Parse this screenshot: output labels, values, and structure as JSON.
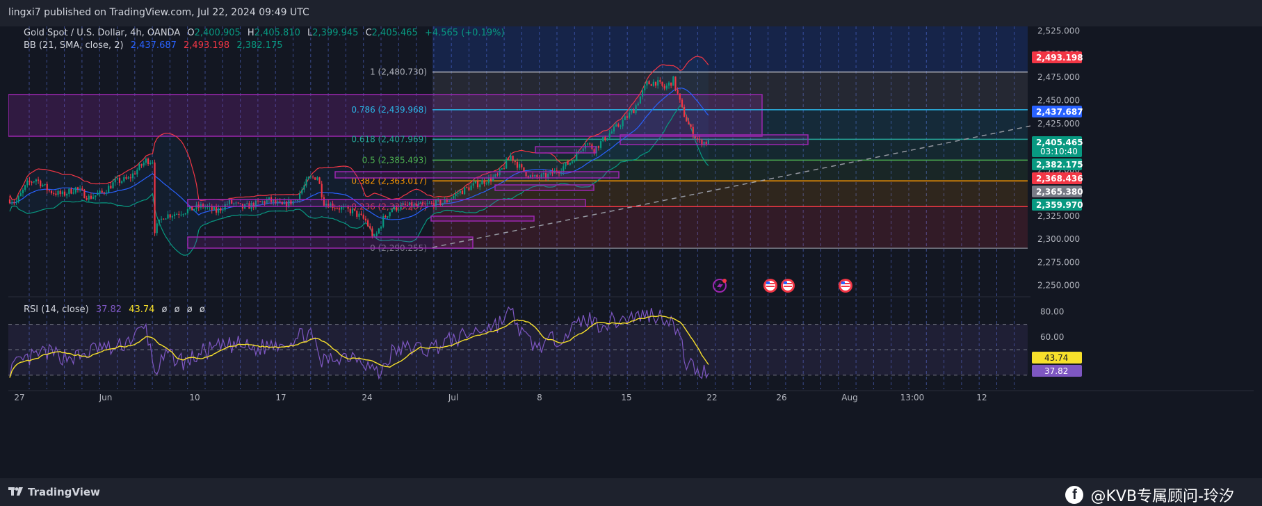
{
  "header": {
    "publish_text": "lingxi7 published on TradingView.com, Jul 22, 2024 09:49 UTC"
  },
  "legend": {
    "symbol": "Gold Spot / U.S. Dollar, 4h, OANDA",
    "open_label": "O",
    "open": "2,400.905",
    "high_label": "H",
    "high": "2,405.810",
    "low_label": "L",
    "low": "2,399.945",
    "close_label": "C",
    "close": "2,405.465",
    "change": "+4.565 (+0.19%)",
    "bb_label": "BB (21, SMA, close, 2)",
    "bb_basis": "2,437.687",
    "bb_upper": "2,493.198",
    "bb_lower": "2,382.175",
    "rsi_label": "RSI (14, close)",
    "rsi_value": "37.82",
    "rsi_ma": "43.74",
    "rsi_extra": [
      "ø",
      "ø",
      "ø",
      "ø"
    ]
  },
  "price_axis": {
    "ticks": [
      "2,525.000",
      "2,500.000",
      "2,475.000",
      "2,450.000",
      "2,425.000",
      "2,400.000",
      "2,375.000",
      "2,350.000",
      "2,325.000",
      "2,300.000",
      "2,275.000",
      "2,250.000"
    ],
    "badges": [
      {
        "value": "2,493.198",
        "color": "#f23645"
      },
      {
        "value": "2,437.687",
        "color": "#2962ff"
      },
      {
        "value": "2,405.465",
        "color": "#089981",
        "sub": "03:10:40"
      },
      {
        "value": "2,382.175",
        "color": "#089981"
      },
      {
        "value": "2,368.436",
        "color": "#f23645"
      },
      {
        "value": "2,365.380",
        "color": "#787b86"
      },
      {
        "value": "2,359.970",
        "color": "#089981"
      }
    ]
  },
  "rsi_axis": {
    "ticks": [
      "80.00",
      "60.00"
    ],
    "badges": [
      {
        "value": "43.74",
        "color": "#f7e02b"
      },
      {
        "value": "37.82",
        "color": "#7e57c2"
      }
    ]
  },
  "fib_levels": [
    {
      "label": "1 (2,480.730)",
      "price": 2480.73,
      "color": "#b2b5be"
    },
    {
      "label": "0.786 (2,439.968)",
      "price": 2439.968,
      "color": "#2bb6e8"
    },
    {
      "label": "0.618 (2,407.969)",
      "price": 2407.969,
      "color": "#26a69a"
    },
    {
      "label": "0.5 (2,385.493)",
      "price": 2385.493,
      "color": "#4caf50"
    },
    {
      "label": "0.382 (2,363.017)",
      "price": 2363.017,
      "color": "#ff9800"
    },
    {
      "label": "0.236 (2,335.207)",
      "price": 2335.207,
      "color": "#f23645"
    },
    {
      "label": "0 (2,290.255)",
      "price": 2290.255,
      "color": "#787b86"
    }
  ],
  "time_axis": [
    "27",
    "Jun",
    "10",
    "17",
    "24",
    "Jul",
    "8",
    "15",
    "22",
    "26",
    "Aug",
    "13:00",
    "12"
  ],
  "events": {
    "flash": "lightning-icon",
    "flags": [
      "us-flag-icon",
      "us-flag-icon",
      "us-flag-icon"
    ]
  },
  "footer": {
    "brand": "TradingView",
    "watermark": "@KVB专属顾问-玲汐",
    "fb": "f"
  },
  "colors": {
    "bg": "#131722",
    "up": "#089981",
    "down": "#f23645",
    "bb_upper": "#f23645",
    "bb_basis": "#2962ff",
    "bb_lower": "#089981",
    "rsi": "#7e57c2",
    "rsi_ma": "#f7e02b"
  },
  "chart_data": {
    "type": "candlestick",
    "timeframe": "4h",
    "ylim": [
      2240,
      2530
    ],
    "rsi_ylim": [
      20,
      90
    ],
    "rsi_levels": [
      70,
      50,
      30
    ],
    "anchors_price": [
      [
        0,
        2343
      ],
      [
        3,
        2340
      ],
      [
        8,
        2360
      ],
      [
        12,
        2365
      ],
      [
        18,
        2352
      ],
      [
        24,
        2348
      ],
      [
        30,
        2355
      ],
      [
        36,
        2345
      ],
      [
        42,
        2350
      ],
      [
        48,
        2362
      ],
      [
        54,
        2365
      ],
      [
        58,
        2375
      ],
      [
        62,
        2385
      ],
      [
        65,
        2385
      ],
      [
        66,
        2310
      ],
      [
        70,
        2325
      ],
      [
        76,
        2328
      ],
      [
        82,
        2332
      ],
      [
        88,
        2336
      ],
      [
        94,
        2330
      ],
      [
        100,
        2340
      ],
      [
        106,
        2334
      ],
      [
        112,
        2338
      ],
      [
        118,
        2342
      ],
      [
        124,
        2336
      ],
      [
        130,
        2342
      ],
      [
        136,
        2365
      ],
      [
        140,
        2368
      ],
      [
        143,
        2340
      ],
      [
        150,
        2334
      ],
      [
        156,
        2330
      ],
      [
        162,
        2320
      ],
      [
        166,
        2300
      ],
      [
        170,
        2322
      ],
      [
        174,
        2333
      ],
      [
        180,
        2336
      ],
      [
        186,
        2336
      ],
      [
        192,
        2338
      ],
      [
        198,
        2340
      ],
      [
        204,
        2350
      ],
      [
        210,
        2357
      ],
      [
        216,
        2363
      ],
      [
        222,
        2368
      ],
      [
        228,
        2390
      ],
      [
        233,
        2375
      ],
      [
        238,
        2366
      ],
      [
        244,
        2368
      ],
      [
        250,
        2375
      ],
      [
        256,
        2385
      ],
      [
        262,
        2405
      ],
      [
        266,
        2397
      ],
      [
        272,
        2412
      ],
      [
        278,
        2425
      ],
      [
        284,
        2440
      ],
      [
        290,
        2468
      ],
      [
        294,
        2470
      ],
      [
        298,
        2463
      ],
      [
        302,
        2472
      ],
      [
        306,
        2440
      ],
      [
        310,
        2418
      ],
      [
        314,
        2405
      ],
      [
        318,
        2405
      ]
    ],
    "anchors_rsi": [
      [
        0,
        35
      ],
      [
        8,
        42
      ],
      [
        16,
        48
      ],
      [
        24,
        45
      ],
      [
        32,
        44
      ],
      [
        40,
        52
      ],
      [
        48,
        50
      ],
      [
        56,
        60
      ],
      [
        62,
        67
      ],
      [
        66,
        33
      ],
      [
        72,
        46
      ],
      [
        80,
        40
      ],
      [
        88,
        48
      ],
      [
        96,
        52
      ],
      [
        104,
        54
      ],
      [
        112,
        50
      ],
      [
        120,
        55
      ],
      [
        130,
        58
      ],
      [
        136,
        65
      ],
      [
        142,
        40
      ],
      [
        150,
        45
      ],
      [
        158,
        46
      ],
      [
        164,
        37
      ],
      [
        168,
        30
      ],
      [
        174,
        48
      ],
      [
        182,
        52
      ],
      [
        190,
        50
      ],
      [
        198,
        56
      ],
      [
        206,
        60
      ],
      [
        214,
        66
      ],
      [
        222,
        70
      ],
      [
        228,
        80
      ],
      [
        234,
        60
      ],
      [
        240,
        52
      ],
      [
        248,
        58
      ],
      [
        256,
        66
      ],
      [
        262,
        75
      ],
      [
        268,
        70
      ],
      [
        276,
        73
      ],
      [
        284,
        76
      ],
      [
        292,
        78
      ],
      [
        300,
        75
      ],
      [
        304,
        63
      ],
      [
        308,
        40
      ],
      [
        314,
        32
      ],
      [
        318,
        34
      ]
    ]
  }
}
